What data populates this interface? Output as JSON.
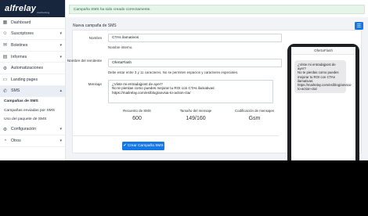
{
  "brand": {
    "name": "alfrelay",
    "tagline": "marketing"
  },
  "alert": {
    "text": "Campaña SMS ha sido creado correctamente."
  },
  "sidebar": {
    "items": [
      {
        "label": "Dashboard",
        "icon": "dashboard-icon"
      },
      {
        "label": "Suscriptores",
        "icon": "users-icon"
      },
      {
        "label": "Boletines",
        "icon": "newsletter-icon"
      },
      {
        "label": "Informes",
        "icon": "reports-icon"
      },
      {
        "label": "Automatizaciones",
        "icon": "automation-icon"
      },
      {
        "label": "Landing pages",
        "icon": "landing-icon"
      },
      {
        "label": "SMS",
        "icon": "sms-icon"
      }
    ],
    "sms_sub": [
      {
        "label": "Campañas de SMS"
      },
      {
        "label": "Campañas enviadas por SMS"
      },
      {
        "label": "Uso del paquete de SMS"
      }
    ],
    "bottom": [
      {
        "label": "Configuración",
        "icon": "gear-icon"
      },
      {
        "label": "Otros",
        "icon": "other-icon"
      }
    ]
  },
  "page": {
    "title": "Nueva campaña de SMS"
  },
  "form": {
    "name_label": "Nombre",
    "name_value": "CTAs ilamativos",
    "name_help": "Nombre interno.",
    "sender_label": "Nombre del remitente",
    "sender_value": "OfertaFlash",
    "sender_help": "Debe estar entre 3 y 11 caracteres. No se permiten espacios y caracteres especiales.",
    "message_label": "Mensaje",
    "message_value": "¿Viste mi entradajpost de ayer?\nNo te pierdas como puedes mejorar tu ROI con CTAs ilamativas:\nhttps://mailrelay.com/es/blog/anvsai-to-action-cta/"
  },
  "stats": {
    "count_label": "Recuento de SMS",
    "count_value": "600",
    "size_label": "Tamaño del mensaje",
    "size_value": "149/160",
    "encoding_label": "Codificación de mensajes",
    "encoding_value": "Gsm"
  },
  "submit_label": "✔ Crear Campaña SMS",
  "phone": {
    "sender": "OfertaFlash",
    "message": "¿Viste mi entradajpost de ayer?\nNo te pierdas como puedes mejorar tu ROI con CTAs ilamativas:\nhttps://mailrelay.com/es/blog/anvsai-to-action-cta/"
  },
  "colors": {
    "accent": "#1677e6",
    "sidebar_header": "#17253d",
    "alert_bg": "#e6f4ea"
  }
}
